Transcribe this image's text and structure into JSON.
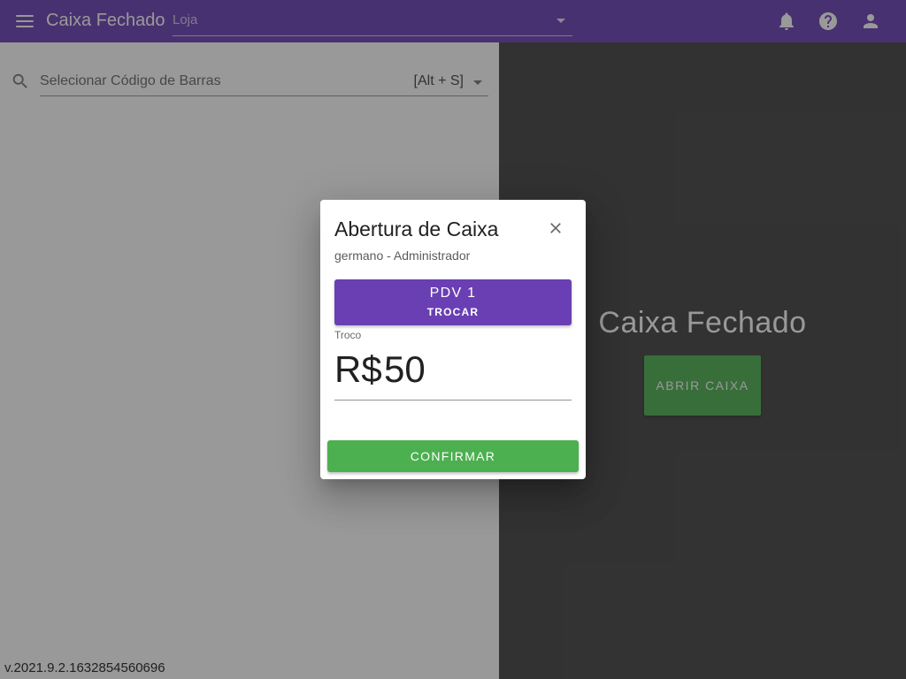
{
  "topbar": {
    "title": "Caixa Fechado",
    "store_placeholder": "Loja",
    "menu_icon": "menu-icon",
    "notification_icon": "bell-icon",
    "help_icon": "help-circle-icon",
    "account_icon": "account-icon",
    "color": "#6a3fb3"
  },
  "search": {
    "placeholder": "Selecionar Código de Barras",
    "shortcut": "[Alt + S]",
    "icon": "search-icon"
  },
  "version": "v.2021.9.2.1632854560696",
  "right_panel": {
    "title": "Caixa Fechado",
    "open_button_label": "ABRIR CAIXA"
  },
  "dialog": {
    "title": "Abertura de Caixa",
    "subtitle": "germano - Administrador",
    "pdv": {
      "name": "PDV 1",
      "action": "TROCAR"
    },
    "troco": {
      "label": "Troco",
      "currency": "R$",
      "value": "50"
    },
    "confirm_label": "CONFIRMAR",
    "close_icon": "close-icon"
  },
  "colors": {
    "primary": "#6a3fb3",
    "success": "#4caf50",
    "dark_panel": "#424242"
  }
}
